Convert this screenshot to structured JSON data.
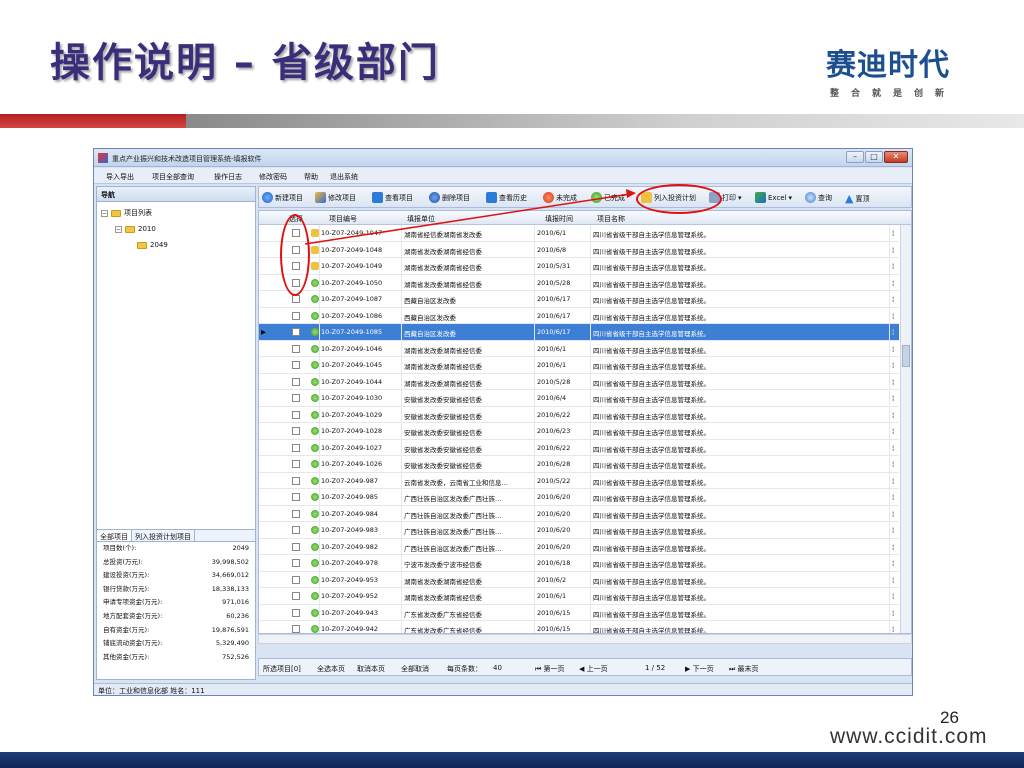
{
  "slide": {
    "title": "操作说明 – 省级部门",
    "logo_main": "赛迪时代",
    "logo_sub": "整合就是创新",
    "page_number": "26",
    "url": "www.ccidit.com"
  },
  "window": {
    "title": "重点产业振兴和技术改造项目管理系统-填报软件",
    "controls": {
      "minimize": "–",
      "maximize": "□",
      "close": "✕"
    }
  },
  "menu": [
    "导入导出",
    "项目全部查询",
    "操作日志",
    "修改密码",
    "帮助",
    "退出系统"
  ],
  "nav": {
    "header": "导航",
    "tree": [
      {
        "label": "项目列表",
        "level": 0
      },
      {
        "label": "2010",
        "level": 1
      },
      {
        "label": "2049",
        "level": 2
      }
    ]
  },
  "summary": {
    "tabs": [
      "全部项目",
      "列入投资计划项目"
    ],
    "rows": [
      {
        "label": "项目数(个):",
        "value": "2049"
      },
      {
        "label": "总投资(万元):",
        "value": "39,998,502"
      },
      {
        "label": "建设投资(万元):",
        "value": "34,669,012"
      },
      {
        "label": "银行贷款(万元):",
        "value": "18,338,133"
      },
      {
        "label": "申请专项资金(万元):",
        "value": "971,016"
      },
      {
        "label": "地方配套资金(万元):",
        "value": "60,236"
      },
      {
        "label": "自有资金(万元):",
        "value": "19,876,591"
      },
      {
        "label": "铺底流动资金(万元):",
        "value": "5,329,490"
      },
      {
        "label": "其他资金(万元):",
        "value": "752,526"
      }
    ]
  },
  "toolbar": {
    "new": "新建项目",
    "edit": "修改项目",
    "view": "查看项目",
    "delete": "删除项目",
    "history": "查看历史",
    "unfinished": "未完成",
    "finished": "已完成",
    "plan": "列入投资计划",
    "print": "打印",
    "excel": "Excel",
    "query": "查询",
    "top": "置顶"
  },
  "grid": {
    "headers": {
      "select": "选择",
      "code": "项目编号",
      "unit": "填报单位",
      "time": "填报时间",
      "name": "项目名称"
    },
    "rows": [
      {
        "status": "lock",
        "code": "10-Z07-2049-1047",
        "unit": "湖南省经信委湖南省发改委",
        "date": "2010/6/1",
        "name": "四川省省级干部自主选学信息管理系统。"
      },
      {
        "status": "lock",
        "code": "10-Z07-2049-1048",
        "unit": "湖南省发改委湖南省经信委",
        "date": "2010/6/8",
        "name": "四川省省级干部自主选学信息管理系统。"
      },
      {
        "status": "lock",
        "code": "10-Z07-2049-1049",
        "unit": "湖南省发改委湖南省经信委",
        "date": "2010/5/31",
        "name": "四川省省级干部自主选学信息管理系统。"
      },
      {
        "status": "done",
        "code": "10-Z07-2049-1050",
        "unit": "湖南省发改委湖南省经信委",
        "date": "2010/5/28",
        "name": "四川省省级干部自主选学信息管理系统。"
      },
      {
        "status": "done",
        "code": "10-Z07-2049-1087",
        "unit": "西藏自治区发改委",
        "date": "2010/6/17",
        "name": "四川省省级干部自主选学信息管理系统。"
      },
      {
        "status": "done",
        "code": "10-Z07-2049-1086",
        "unit": "西藏自治区发改委",
        "date": "2010/6/17",
        "name": "四川省省级干部自主选学信息管理系统。"
      },
      {
        "status": "done",
        "code": "10-Z07-2049-1085",
        "unit": "西藏自治区发改委",
        "date": "2010/6/17",
        "name": "四川省省级干部自主选学信息管理系统。",
        "selected": true
      },
      {
        "status": "done",
        "code": "10-Z07-2049-1046",
        "unit": "湖南省发改委湖南省经信委",
        "date": "2010/6/1",
        "name": "四川省省级干部自主选学信息管理系统。"
      },
      {
        "status": "done",
        "code": "10-Z07-2049-1045",
        "unit": "湖南省发改委湖南省经信委",
        "date": "2010/6/1",
        "name": "四川省省级干部自主选学信息管理系统。"
      },
      {
        "status": "done",
        "code": "10-Z07-2049-1044",
        "unit": "湖南省发改委湖南省经信委",
        "date": "2010/5/28",
        "name": "四川省省级干部自主选学信息管理系统。"
      },
      {
        "status": "done",
        "code": "10-Z07-2049-1030",
        "unit": "安徽省发改委安徽省经信委",
        "date": "2010/6/4",
        "name": "四川省省级干部自主选学信息管理系统。"
      },
      {
        "status": "done",
        "code": "10-Z07-2049-1029",
        "unit": "安徽省发改委安徽省经信委",
        "date": "2010/6/22",
        "name": "四川省省级干部自主选学信息管理系统。"
      },
      {
        "status": "done",
        "code": "10-Z07-2049-1028",
        "unit": "安徽省发改委安徽省经信委",
        "date": "2010/6/23",
        "name": "四川省省级干部自主选学信息管理系统。"
      },
      {
        "status": "done",
        "code": "10-Z07-2049-1027",
        "unit": "安徽省发改委安徽省经信委",
        "date": "2010/6/22",
        "name": "四川省省级干部自主选学信息管理系统。"
      },
      {
        "status": "done",
        "code": "10-Z07-2049-1026",
        "unit": "安徽省发改委安徽省经信委",
        "date": "2010/6/28",
        "name": "四川省省级干部自主选学信息管理系统。"
      },
      {
        "status": "done",
        "code": "10-Z07-2049-987",
        "unit": "云南省发改委，云南省工业和信息…",
        "date": "2010/5/22",
        "name": "四川省省级干部自主选学信息管理系统。"
      },
      {
        "status": "done",
        "code": "10-Z07-2049-985",
        "unit": "广西壮族自治区发改委广西壮族…",
        "date": "2010/6/20",
        "name": "四川省省级干部自主选学信息管理系统。"
      },
      {
        "status": "done",
        "code": "10-Z07-2049-984",
        "unit": "广西壮族自治区发改委广西壮族…",
        "date": "2010/6/20",
        "name": "四川省省级干部自主选学信息管理系统。"
      },
      {
        "status": "done",
        "code": "10-Z07-2049-983",
        "unit": "广西壮族自治区发改委广西壮族…",
        "date": "2010/6/20",
        "name": "四川省省级干部自主选学信息管理系统。"
      },
      {
        "status": "done",
        "code": "10-Z07-2049-982",
        "unit": "广西壮族自治区发改委广西壮族…",
        "date": "2010/6/20",
        "name": "四川省省级干部自主选学信息管理系统。"
      },
      {
        "status": "done",
        "code": "10-Z07-2049-978",
        "unit": "宁波市发改委宁波市经信委",
        "date": "2010/6/18",
        "name": "四川省省级干部自主选学信息管理系统。"
      },
      {
        "status": "done",
        "code": "10-Z07-2049-953",
        "unit": "湖南省发改委湖南省经信委",
        "date": "2010/6/2",
        "name": "四川省省级干部自主选学信息管理系统。"
      },
      {
        "status": "done",
        "code": "10-Z07-2049-952",
        "unit": "湖南省发改委湖南省经信委",
        "date": "2010/6/1",
        "name": "四川省省级干部自主选学信息管理系统。"
      },
      {
        "status": "done",
        "code": "10-Z07-2049-943",
        "unit": "广东省发改委广东省经信委",
        "date": "2010/6/15",
        "name": "四川省省级干部自主选学信息管理系统。"
      },
      {
        "status": "done",
        "code": "10-Z07-2049-942",
        "unit": "广东省发改委广东省经信委",
        "date": "2010/6/15",
        "name": "四川省省级干部自主选学信息管理系统。"
      }
    ]
  },
  "pager": {
    "selected": "所选项目[0]",
    "select_page": "全选本页",
    "cancel_page": "取消本页",
    "cancel_all": "全部取消",
    "per_page_label": "每页条数：",
    "per_page": "40",
    "first": "第一页",
    "prev": "上一页",
    "page_info": "1  / 52",
    "next": "下一页",
    "last": "最末页"
  },
  "status_bar": "单位：工业和信息化部  姓名：111",
  "colors": {
    "title": "#3a2e7a",
    "selected_row": "#3e7fd6",
    "annotation": "#e01010",
    "logo": "#1d4f8f"
  }
}
